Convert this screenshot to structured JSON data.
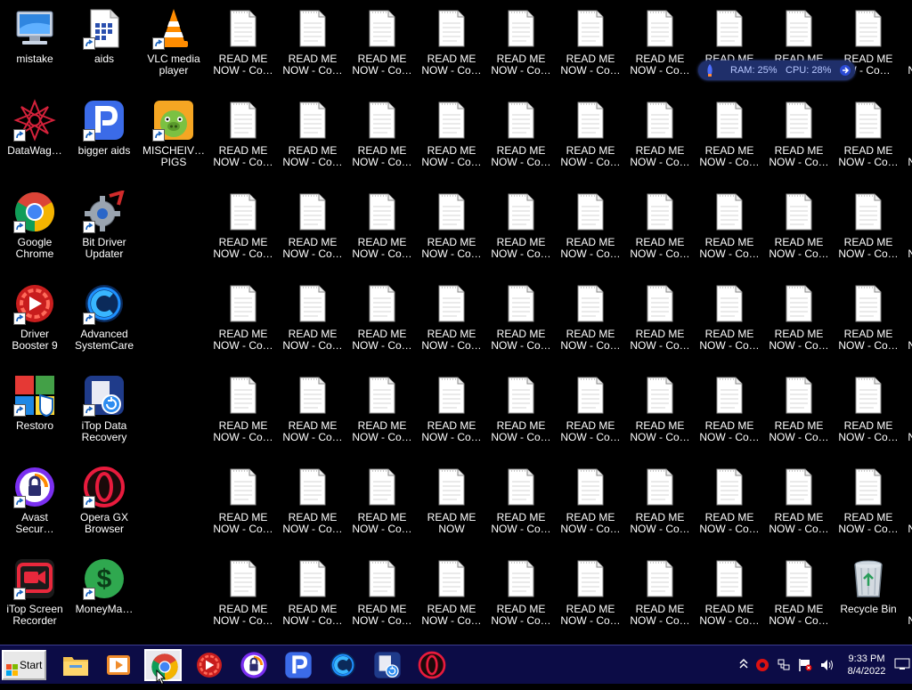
{
  "desktop": {
    "left_icons": [
      {
        "label": "mistake",
        "icon": "computer-icon",
        "shortcut": false
      },
      {
        "label": "aids",
        "icon": "document-icon",
        "shortcut": true
      },
      {
        "label": "VLC media\nplayer",
        "icon": "vlc-cone-icon",
        "shortcut": true
      },
      {
        "label": "DataWag…",
        "icon": "datawag-icon",
        "shortcut": true
      },
      {
        "label": "bigger aids",
        "icon": "p-letter-icon",
        "shortcut": true
      },
      {
        "label": "MISCHEIV…\nPIGS",
        "icon": "pig-game-icon",
        "shortcut": true
      },
      {
        "label": "Google\nChrome",
        "icon": "chrome-icon",
        "shortcut": true
      },
      {
        "label": "Bit Driver\nUpdater",
        "icon": "gear-icon",
        "shortcut": true
      },
      {
        "label": "Driver\nBooster 9",
        "icon": "driver-booster-icon",
        "shortcut": true
      },
      {
        "label": "Advanced\nSystemCare",
        "icon": "systemcare-icon",
        "shortcut": true
      },
      {
        "label": "Restoro",
        "icon": "restoro-icon",
        "shortcut": true
      },
      {
        "label": "iTop Data\nRecovery",
        "icon": "data-recovery-icon",
        "shortcut": true
      },
      {
        "label": "Avast\nSecur…",
        "icon": "avast-lock-icon",
        "shortcut": true
      },
      {
        "label": "Opera GX\nBrowser",
        "icon": "opera-gx-icon",
        "shortcut": true
      },
      {
        "label": "iTop Screen\nRecorder",
        "icon": "screen-recorder-icon",
        "shortcut": true
      },
      {
        "label": "MoneyMa…",
        "icon": "money-icon",
        "shortcut": true
      }
    ],
    "file_label": "READ ME\nNOW - Co…",
    "file_label_alt": "READ ME\nNOW",
    "file_label_partial": "READ ME\nW - Co…",
    "recycle_bin": {
      "label": "Recycle Bin"
    }
  },
  "monitor": {
    "ram": "RAM: 25%",
    "cpu": "CPU: 28%"
  },
  "taskbar": {
    "start_label": "Start",
    "pinned": [
      {
        "name": "file-explorer",
        "icon": "folder-icon"
      },
      {
        "name": "media-player",
        "icon": "media-player-icon"
      },
      {
        "name": "google-chrome",
        "icon": "chrome-icon",
        "active": true
      },
      {
        "name": "driver-booster",
        "icon": "driver-booster-icon"
      },
      {
        "name": "avast",
        "icon": "avast-lock-icon"
      },
      {
        "name": "bigger-aids",
        "icon": "p-letter-icon"
      },
      {
        "name": "advanced-systemcare",
        "icon": "systemcare-icon"
      },
      {
        "name": "itop-data-recovery",
        "icon": "data-recovery-icon"
      },
      {
        "name": "opera-gx",
        "icon": "opera-gx-icon"
      }
    ],
    "tray": {
      "time": "9:33 PM",
      "date": "8/4/2022"
    }
  },
  "colors": {
    "desktop_bg": "#000000",
    "taskbar_bg": "#0c0c46",
    "monitor_bg": "#1f2f6a"
  }
}
